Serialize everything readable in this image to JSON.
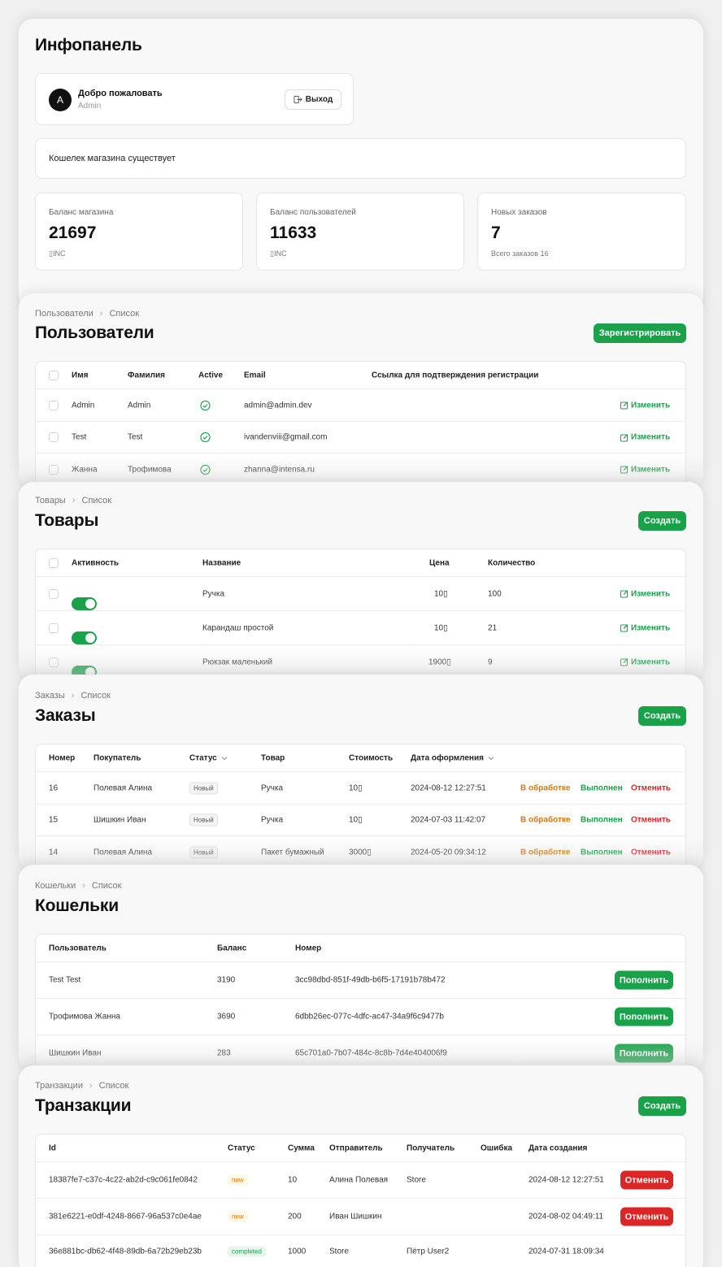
{
  "dashboard": {
    "title": "Инфопанель",
    "welcome": {
      "avatar": "A",
      "title": "Добро пожаловать",
      "subtitle": "Admin",
      "logout": "Выход"
    },
    "wallet_status": "Кошелек магазина существует",
    "stats": [
      {
        "label": "Баланс магазина",
        "value": "21697",
        "sub": "▯INC"
      },
      {
        "label": "Баланс пользователей",
        "value": "11633",
        "sub": "▯INC"
      },
      {
        "label": "Новых заказов",
        "value": "7",
        "sub": "Всего заказов 16"
      }
    ]
  },
  "users": {
    "breadcrumb": [
      "Пользователи",
      "Список"
    ],
    "title": "Пользователи",
    "action": "Зарегистрировать",
    "columns": [
      "Имя",
      "Фамилия",
      "Active",
      "Email",
      "Ссылка для подтверждения регистрации"
    ],
    "rows": [
      {
        "first": "Admin",
        "last": "Admin",
        "email": "admin@admin.dev",
        "edit": "Изменить"
      },
      {
        "first": "Test",
        "last": "Test",
        "email": "ivandenviii@gmail.com",
        "edit": "Изменить"
      },
      {
        "first": "Жанна",
        "last": "Трофимова",
        "email": "zhanna@intensa.ru",
        "edit": "Изменить"
      }
    ]
  },
  "products": {
    "breadcrumb": [
      "Товары",
      "Список"
    ],
    "title": "Товары",
    "action": "Создать",
    "columns": [
      "Активность",
      "Название",
      "Цена",
      "Количество"
    ],
    "rows": [
      {
        "name": "Ручка",
        "price": "10▯",
        "qty": "100",
        "active": true,
        "edit": "Изменить"
      },
      {
        "name": "Карандаш простой",
        "price": "10▯",
        "qty": "21",
        "active": true,
        "edit": "Изменить"
      },
      {
        "name": "Рюкзак маленький",
        "price": "1900▯",
        "qty": "9",
        "active": true,
        "edit": "Изменить"
      }
    ]
  },
  "orders": {
    "breadcrumb": [
      "Заказы",
      "Список"
    ],
    "title": "Заказы",
    "action": "Создать",
    "columns": [
      "Номер",
      "Покупатель",
      "Статус",
      "Товар",
      "Стоимость",
      "Дата оформления"
    ],
    "actions": [
      "В обработке",
      "Выполнен",
      "Отменить"
    ],
    "rows": [
      {
        "num": "16",
        "buyer": "Полевая Алина",
        "status": "Новый",
        "item": "Ручка",
        "cost": "10▯",
        "date": "2024-08-12 12:27:51"
      },
      {
        "num": "15",
        "buyer": "Шишкин Иван",
        "status": "Новый",
        "item": "Ручка",
        "cost": "10▯",
        "date": "2024-07-03 11:42:07"
      },
      {
        "num": "14",
        "buyer": "Полевая Алина",
        "status": "Новый",
        "item": "Пакет бумажный",
        "cost": "3000▯",
        "date": "2024-05-20 09:34:12"
      }
    ]
  },
  "wallets": {
    "breadcrumb": [
      "Кошельки",
      "Список"
    ],
    "title": "Кошельки",
    "columns": [
      "Пользователь",
      "Баланс",
      "Номер"
    ],
    "rows": [
      {
        "user": "Test Test",
        "balance": "3190",
        "number": "3cc98dbd-851f-49db-b6f5-17191b78b472",
        "action": "Пополнить"
      },
      {
        "user": "Трофимова Жанна",
        "balance": "3690",
        "number": "6dbb26ec-077c-4dfc-ac47-34a9f6c9477b",
        "action": "Пополнить"
      },
      {
        "user": "Шишкин Иван",
        "balance": "283",
        "number": "65c701a0-7b07-484c-8c8b-7d4e404006f9",
        "action": "Пополнить"
      }
    ]
  },
  "transactions": {
    "breadcrumb": [
      "Транзакции",
      "Список"
    ],
    "title": "Транзакции",
    "action": "Создать",
    "columns": [
      "Id",
      "Статус",
      "Сумма",
      "Отправитель",
      "Получатель",
      "Ошибка",
      "Дата создания"
    ],
    "rows": [
      {
        "id": "18387fe7-c37c-4c22-ab2d-c9c061fe0842",
        "status": "new",
        "sum": "10",
        "sender": "Алина Полевая",
        "receiver": "Store",
        "date": "2024-08-12 12:27:51",
        "action": "Отменить"
      },
      {
        "id": "381e6221-e0df-4248-8667-96a537c0e4ae",
        "status": "new",
        "sum": "200",
        "sender": "Иван Шишкин",
        "receiver": "",
        "date": "2024-08-02 04:49:11",
        "action": "Отменить"
      },
      {
        "id": "36e881bc-db62-4f48-89db-6a72b29eb23b",
        "status": "completed",
        "sum": "1000",
        "sender": "Store",
        "receiver": "Пётр User2",
        "date": "2024-07-31 18:09:34",
        "action": ""
      }
    ]
  },
  "colors": {
    "accent": "#1aa24a",
    "danger": "#dc2626",
    "warning": "#d97706"
  }
}
